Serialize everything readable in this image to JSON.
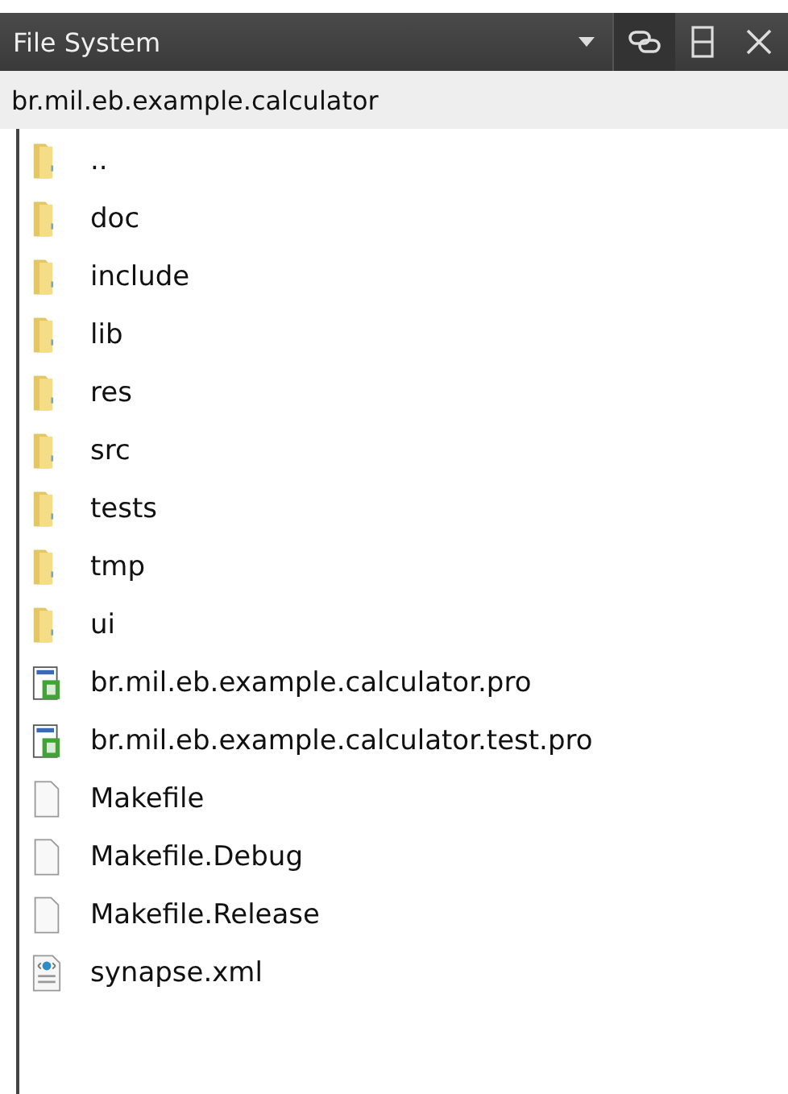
{
  "panel": {
    "title": "File System",
    "path": "br.mil.eb.example.calculator"
  },
  "items": [
    {
      "name": "..",
      "kind": "folder"
    },
    {
      "name": "doc",
      "kind": "folder"
    },
    {
      "name": "include",
      "kind": "folder"
    },
    {
      "name": "lib",
      "kind": "folder"
    },
    {
      "name": "res",
      "kind": "folder"
    },
    {
      "name": "src",
      "kind": "folder"
    },
    {
      "name": "tests",
      "kind": "folder"
    },
    {
      "name": "tmp",
      "kind": "folder"
    },
    {
      "name": "ui",
      "kind": "folder"
    },
    {
      "name": "br.mil.eb.example.calculator.pro",
      "kind": "project"
    },
    {
      "name": "br.mil.eb.example.calculator.test.pro",
      "kind": "project"
    },
    {
      "name": "Makefile",
      "kind": "file"
    },
    {
      "name": "Makefile.Debug",
      "kind": "file"
    },
    {
      "name": "Makefile.Release",
      "kind": "file"
    },
    {
      "name": "synapse.xml",
      "kind": "xml"
    }
  ]
}
